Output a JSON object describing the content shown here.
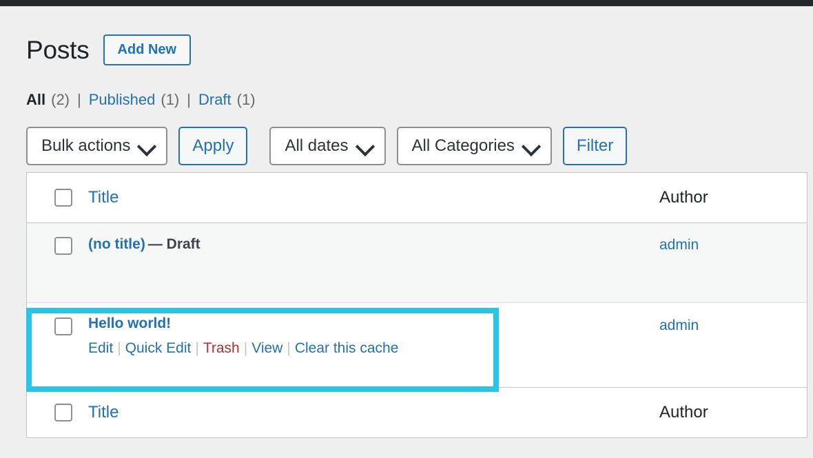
{
  "admin_bar": {
    "present": true
  },
  "header": {
    "title": "Posts",
    "add_new_label": "Add New"
  },
  "status_filters": {
    "items": [
      {
        "label": "All",
        "count": "(2)",
        "current": true
      },
      {
        "label": "Published",
        "count": "(1)",
        "current": false
      },
      {
        "label": "Draft",
        "count": "(1)",
        "current": false
      }
    ],
    "separator": "|"
  },
  "tablenav": {
    "bulk_actions_value": "Bulk actions",
    "apply_label": "Apply",
    "dates_value": "All dates",
    "categories_value": "All Categories",
    "filter_label": "Filter"
  },
  "table": {
    "columns": {
      "title": "Title",
      "author": "Author"
    },
    "rows": [
      {
        "title": "(no title)",
        "post_state": "— Draft",
        "author": "admin",
        "actions": [],
        "alt": true,
        "highlighted": false
      },
      {
        "title": "Hello world!",
        "post_state": "",
        "author": "admin",
        "actions": [
          {
            "label": "Edit",
            "kind": "link"
          },
          {
            "label": "Quick Edit",
            "kind": "link"
          },
          {
            "label": "Trash",
            "kind": "trash"
          },
          {
            "label": "View",
            "kind": "link"
          },
          {
            "label": "Clear this cache",
            "kind": "link"
          }
        ],
        "alt": false,
        "highlighted": true
      }
    ],
    "action_separator": "|"
  },
  "colors": {
    "link": "#2271b1",
    "trash": "#b32d2e",
    "highlight": "#29c5e6",
    "admin_bar": "#23282d",
    "page_bg": "#efefef",
    "alt_row": "#f6f7f7"
  }
}
